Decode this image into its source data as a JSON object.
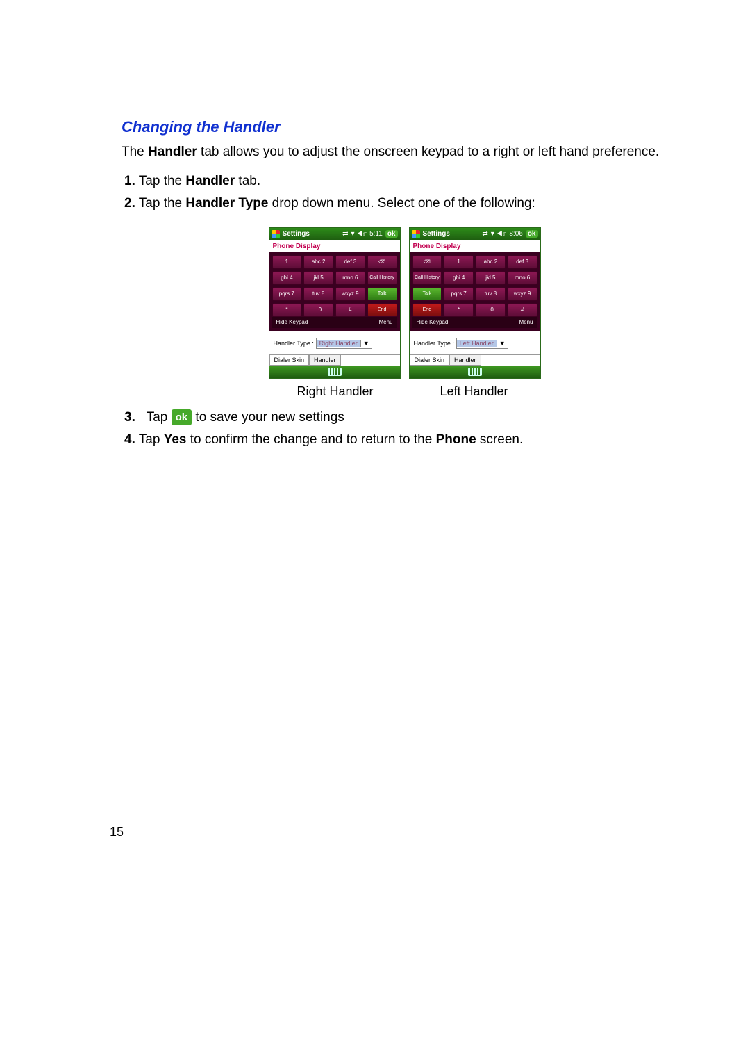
{
  "heading": "Changing the Handler",
  "intro": {
    "pre": "The ",
    "b1": "Handler",
    "post": " tab allows you to adjust the onscreen keypad to a right or left hand preference."
  },
  "steps": {
    "s1": {
      "n": "1.",
      "pre": "Tap the ",
      "b": "Handler",
      "post": " tab."
    },
    "s2": {
      "n": "2.",
      "pre": "Tap the ",
      "b": "Handler Type",
      "post": " drop down menu. Select one of the following:"
    },
    "s3": {
      "n": "3.",
      "pre": "Tap ",
      "ok": "ok",
      "post": " to save your new settings"
    },
    "s4": {
      "n": "4.",
      "pre": "Tap ",
      "b1": "Yes",
      "mid": " to confirm the change and to return to the ",
      "b2": "Phone",
      "post": " screen."
    }
  },
  "captions": {
    "left": "Right Handler",
    "right": "Left Handler"
  },
  "pagenum": "15",
  "phone": {
    "title": "Settings",
    "ok": "ok",
    "subtitle": "Phone Display",
    "timeA": "5:11",
    "timeB": "8:06",
    "keysNum": [
      "1",
      "abc 2",
      "def 3",
      "ghi 4",
      "jkl 5",
      "mno 6",
      "pqrs 7",
      "tuv 8",
      "wxyz 9",
      "*",
      ". 0",
      "#"
    ],
    "backspace": "⌫",
    "callhist": "Call History",
    "talk": "Talk",
    "end": "End",
    "hide": "Hide Keypad",
    "menu": "Menu",
    "handlerLabel": "Handler Type :",
    "selRight": "Right Handler",
    "selLeft": "Left Handler",
    "tab1": "Dialer Skin",
    "tab2": "Handler"
  }
}
